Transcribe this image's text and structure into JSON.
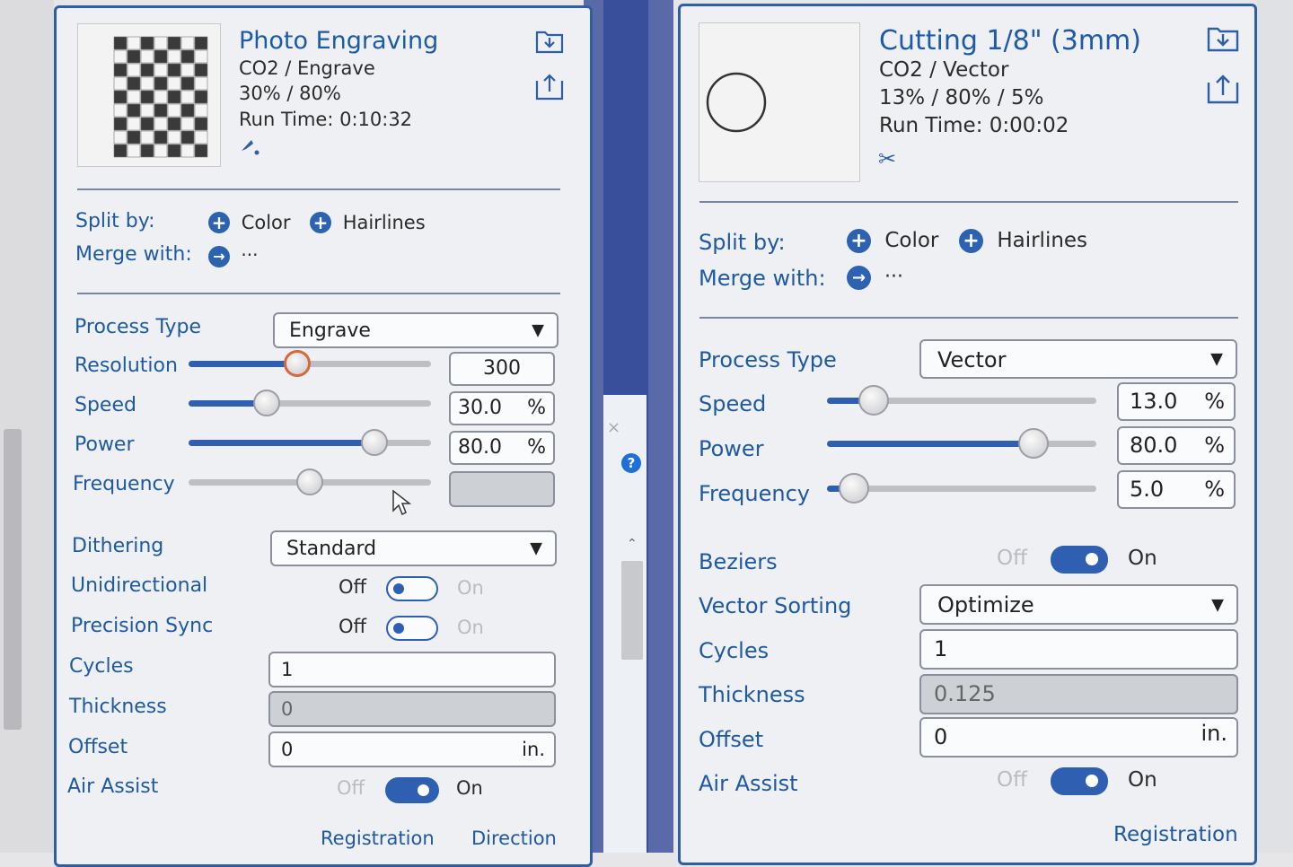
{
  "left": {
    "name": "Photo Engraving",
    "material": "CO2 / Engrave",
    "powers": "30% / 80%",
    "runtime": "Run Time: 0:10:32",
    "split_label": "Split by:",
    "merge_label": "Merge with:",
    "color": "Color",
    "hairlines": "Hairlines",
    "more": "···",
    "fields": {
      "process_type_label": "Process Type",
      "process_type": "Engrave",
      "resolution_label": "Resolution",
      "resolution": "300",
      "speed_label": "Speed",
      "speed": "30.0",
      "speed_pct": 0.3,
      "power_label": "Power",
      "power": "80.0",
      "power_pct": 0.8,
      "frequency_label": "Frequency",
      "frequency_pct": 0.5,
      "resolution_pct": 0.44,
      "dithering_label": "Dithering",
      "dithering": "Standard",
      "unidirectional_label": "Unidirectional",
      "precision_label": "Precision Sync",
      "cycles_label": "Cycles",
      "cycles": "1",
      "thickness_label": "Thickness",
      "thickness": "0",
      "offset_label": "Offset",
      "offset": "0",
      "offset_unit": "in.",
      "air_label": "Air Assist"
    },
    "pct": "%",
    "off": "Off",
    "on": "On",
    "registration": "Registration",
    "direction": "Direction"
  },
  "right": {
    "name": "Cutting 1/8\" (3mm)",
    "material": "CO2 / Vector",
    "powers": "13% / 80% / 5%",
    "runtime": "Run Time: 0:00:02",
    "split_label": "Split by:",
    "merge_label": "Merge with:",
    "color": "Color",
    "hairlines": "Hairlines",
    "more": "···",
    "fields": {
      "process_type_label": "Process Type",
      "process_type": "Vector",
      "speed_label": "Speed",
      "speed": "13.0",
      "speed_pct": 0.13,
      "power_label": "Power",
      "power": "80.0",
      "power_pct": 0.8,
      "frequency_label": "Frequency",
      "frequency": "5.0",
      "frequency_pct": 0.05,
      "beziers_label": "Beziers",
      "vector_sorting_label": "Vector Sorting",
      "vector_sorting": "Optimize",
      "cycles_label": "Cycles",
      "cycles": "1",
      "thickness_label": "Thickness",
      "thickness": "0.125",
      "offset_label": "Offset",
      "offset": "0",
      "offset_unit": "in.",
      "air_label": "Air Assist"
    },
    "pct": "%",
    "off": "Off",
    "on": "On",
    "registration": "Registration"
  },
  "help": "?",
  "icons": [
    "import-icon",
    "export-icon",
    "engrave-tool-icon",
    "scissors-icon",
    "plus-circle-icon",
    "arrow-right-circle-icon",
    "chevron-down-icon",
    "cursor-icon",
    "help-icon"
  ],
  "colors": {
    "accent": "#2e5fb0",
    "label": "#1f5aa0",
    "frame": "#2f5ea8"
  }
}
